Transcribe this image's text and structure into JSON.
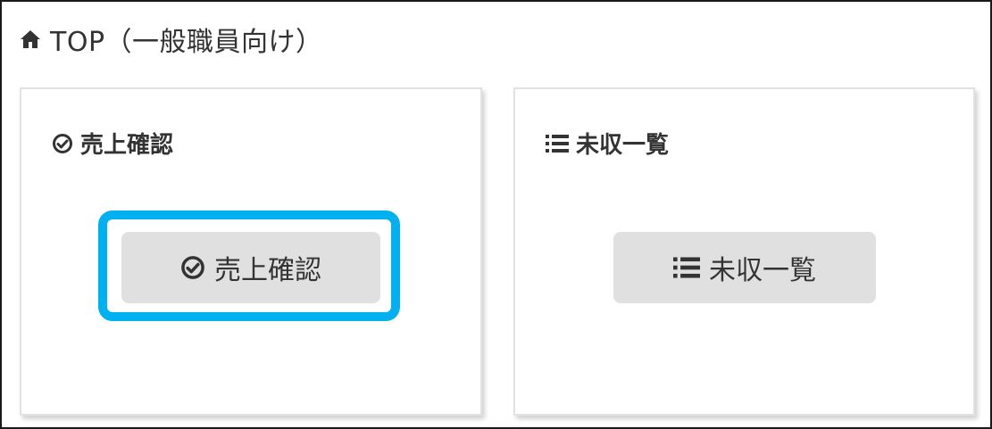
{
  "header": {
    "icon": "home-icon",
    "title": "TOP（一般職員向け）"
  },
  "cards": {
    "sales_confirm": {
      "icon": "check-circle-icon",
      "title": "売上確認",
      "button_label": "売上確認",
      "highlighted": true
    },
    "unpaid_list": {
      "icon": "list-icon",
      "title": "未収一覧",
      "button_label": "未収一覧"
    }
  },
  "colors": {
    "highlight": "#00b0f0",
    "button_bg": "#e0e0e0",
    "text": "#333333"
  }
}
